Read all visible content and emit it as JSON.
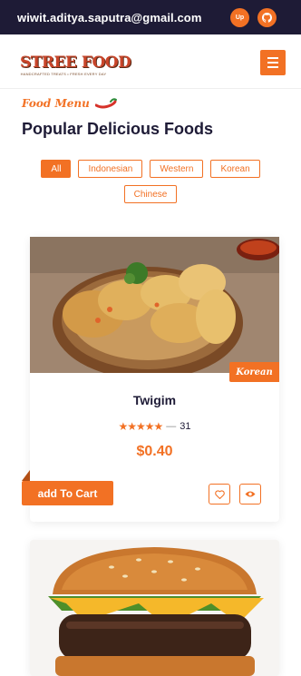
{
  "topbar": {
    "email": "wiwit.aditya.saputra@gmail.com",
    "up_label": "Up",
    "github_icon": "github-icon"
  },
  "header": {
    "logo_text": "STREE FOOD",
    "logo_tagline": "HANDCRAFTED TREATS • FRESH EVERY DAY",
    "menu_icon": "hamburger-menu-icon"
  },
  "section": {
    "subtitle": "Food Menu",
    "title": "Popular Delicious Foods"
  },
  "filters": [
    {
      "label": "All",
      "active": true
    },
    {
      "label": "Indonesian",
      "active": false
    },
    {
      "label": "Western",
      "active": false
    },
    {
      "label": "Korean",
      "active": false
    },
    {
      "label": "Chinese",
      "active": false
    }
  ],
  "products": [
    {
      "name": "Twigim",
      "category": "Korean",
      "rating_stars": "★★★★★",
      "rating_separator": "—",
      "rating_count": "31",
      "price": "$0.40",
      "cart_label": "add To Cart",
      "wishlist_icon": "heart-icon",
      "view_icon": "eye-icon"
    },
    {
      "name": "Burger",
      "image_icon": "burger-image"
    }
  ],
  "colors": {
    "accent": "#f27124",
    "dark": "#1e1b36"
  }
}
